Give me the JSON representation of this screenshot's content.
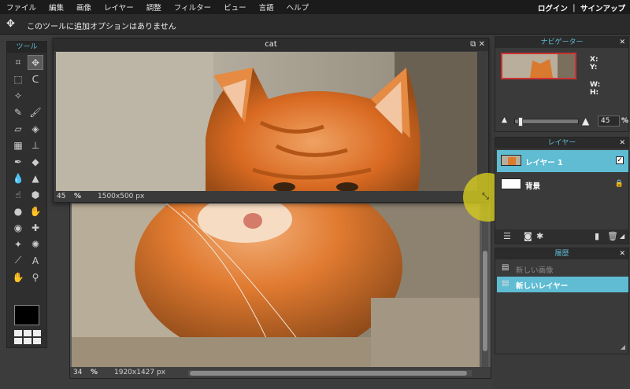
{
  "menu": {
    "items": [
      "ファイル",
      "編集",
      "画像",
      "レイヤー",
      "調整",
      "フィルター",
      "ビュー",
      "言語",
      "ヘルプ"
    ],
    "auth": "ログイン ｜ サインアップ"
  },
  "options_bar": {
    "tool_icon": "move-icon",
    "message": "このツールに追加オプションはありません"
  },
  "toolbox": {
    "title": "ツール",
    "tools": [
      {
        "name": "crop-tool",
        "glyph": "⌗",
        "active": false
      },
      {
        "name": "move-tool",
        "glyph": "✥",
        "active": true
      },
      {
        "name": "marquee-tool",
        "glyph": "⬚",
        "active": false
      },
      {
        "name": "lasso-tool",
        "glyph": "ᑕ",
        "active": false
      },
      {
        "name": "magic-wand-tool",
        "glyph": "✧",
        "active": false
      },
      {
        "name": "blank",
        "glyph": "",
        "active": false
      },
      {
        "name": "pencil-tool",
        "glyph": "✎",
        "active": false
      },
      {
        "name": "brush-tool",
        "glyph": "🖌",
        "active": false
      },
      {
        "name": "eraser-tool",
        "glyph": "▱",
        "active": false
      },
      {
        "name": "bucket-tool",
        "glyph": "◈",
        "active": false
      },
      {
        "name": "gradient-tool",
        "glyph": "▦",
        "active": false
      },
      {
        "name": "stamp-tool",
        "glyph": "⊥",
        "active": false
      },
      {
        "name": "color-replace-tool",
        "glyph": "✒",
        "active": false
      },
      {
        "name": "drawing-tool",
        "glyph": "◆",
        "active": false
      },
      {
        "name": "blur-tool",
        "glyph": "💧",
        "active": false
      },
      {
        "name": "sharpen-tool",
        "glyph": "▲",
        "active": false
      },
      {
        "name": "smudge-tool",
        "glyph": "☝",
        "active": false
      },
      {
        "name": "sponge-tool",
        "glyph": "⬢",
        "active": false
      },
      {
        "name": "dodge-tool",
        "glyph": "●",
        "active": false
      },
      {
        "name": "burn-tool",
        "glyph": "✋",
        "active": false
      },
      {
        "name": "red-eye-tool",
        "glyph": "◉",
        "active": false
      },
      {
        "name": "spot-heal-tool",
        "glyph": "✚",
        "active": false
      },
      {
        "name": "bloat-tool",
        "glyph": "✦",
        "active": false
      },
      {
        "name": "pinch-tool",
        "glyph": "✺",
        "active": false
      },
      {
        "name": "color-picker-tool",
        "glyph": "⟋",
        "active": false
      },
      {
        "name": "type-tool",
        "glyph": "A",
        "active": false
      },
      {
        "name": "hand-tool",
        "glyph": "✋",
        "active": false
      },
      {
        "name": "zoom-tool",
        "glyph": "⚲",
        "active": false
      }
    ],
    "fg_color": "#000000"
  },
  "doc_front": {
    "title": "cat",
    "zoom": "45",
    "pct": "%",
    "size": "1500x500 px"
  },
  "doc_back": {
    "zoom": "34",
    "pct": "%",
    "size": "1920x1427 px"
  },
  "navigator": {
    "title": "ナビゲーター",
    "x_label": "X:",
    "y_label": "Y:",
    "w_label": "W:",
    "h_label": "H:",
    "zoom": "45",
    "pct": "%"
  },
  "layers": {
    "title": "レイヤー",
    "items": [
      {
        "name": "レイヤー 1",
        "selected": true
      },
      {
        "name": "背景",
        "selected": false
      }
    ]
  },
  "history": {
    "title": "履歴",
    "items": [
      {
        "name": "新しい画像",
        "state": "dim"
      },
      {
        "name": "新しいレイヤー",
        "state": "selected"
      }
    ]
  },
  "colors": {
    "accent": "#5fbcd3",
    "cursor_highlight": "#d2c81e"
  }
}
